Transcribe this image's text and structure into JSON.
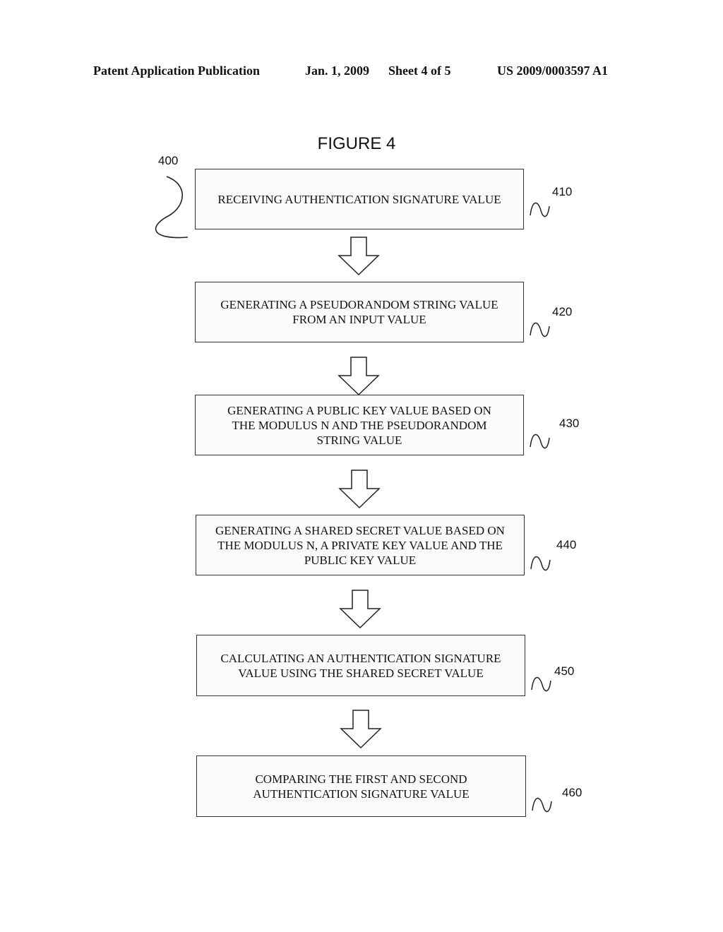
{
  "header": {
    "publication": "Patent Application Publication",
    "date": "Jan. 1, 2009",
    "sheet": "Sheet 4 of 5",
    "number": "US 2009/0003597 A1"
  },
  "figure": {
    "title": "FIGURE 4",
    "reference": "400"
  },
  "steps": [
    {
      "ref": "410",
      "text": "RECEIVING AUTHENTICATION SIGNATURE VALUE"
    },
    {
      "ref": "420",
      "text": "GENERATING A PSEUDORANDOM STRING VALUE\nFROM AN INPUT VALUE"
    },
    {
      "ref": "430",
      "text": "GENERATING A PUBLIC KEY VALUE BASED ON\nTHE MODULUS N AND THE PSEUDORANDOM\nSTRING VALUE"
    },
    {
      "ref": "440",
      "text": "GENERATING A SHARED SECRET VALUE BASED ON\nTHE MODULUS N, A PRIVATE KEY VALUE AND THE\nPUBLIC KEY VALUE"
    },
    {
      "ref": "450",
      "text": "CALCULATING AN AUTHENTICATION SIGNATURE\nVALUE USING THE SHARED SECRET VALUE"
    },
    {
      "ref": "460",
      "text": "COMPARING THE FIRST AND SECOND\nAUTHENTICATION SIGNATURE VALUE"
    }
  ]
}
